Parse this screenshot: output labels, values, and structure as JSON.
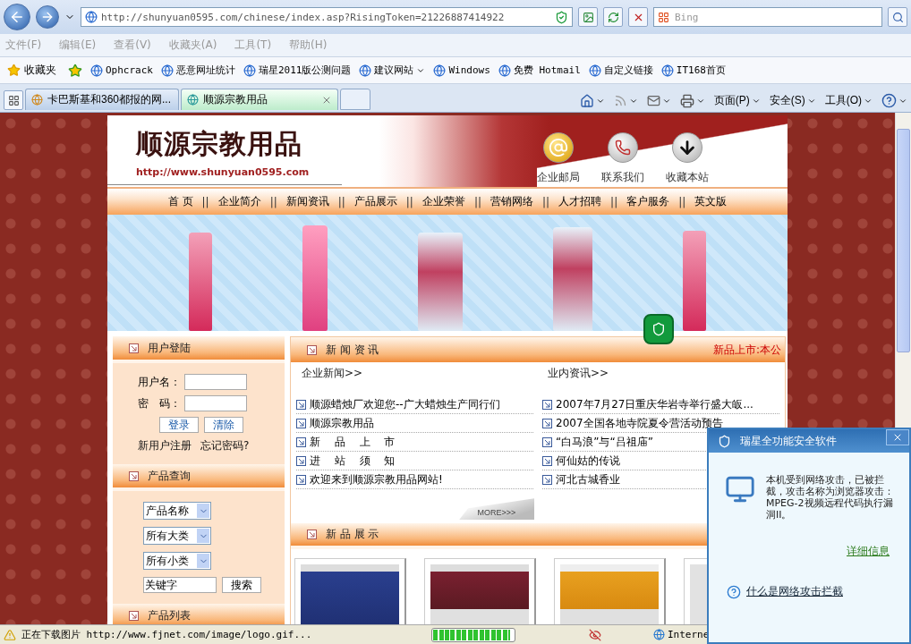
{
  "browser": {
    "address": "http://shunyuan0595.com/chinese/index.asp?RisingToken=21226887414922",
    "search_placeholder": "Bing",
    "menu": [
      "文件(F)",
      "编辑(E)",
      "查看(V)",
      "收藏夹(A)",
      "工具(T)",
      "帮助(H)"
    ],
    "favorites_label": "收藏夹",
    "favorites": [
      {
        "label": "Ophcrack",
        "dropdown": false
      },
      {
        "label": "恶意网址统计",
        "dropdown": false
      },
      {
        "label": "瑞星2011版公测问题",
        "dropdown": false
      },
      {
        "label": "建议网站",
        "dropdown": true
      },
      {
        "label": "Windows",
        "dropdown": false
      },
      {
        "label": "免费 Hotmail",
        "dropdown": false
      },
      {
        "label": "自定义链接",
        "dropdown": false
      },
      {
        "label": "IT168首页",
        "dropdown": false
      }
    ],
    "tabs": [
      {
        "label": "卡巴斯基和360都报的网...",
        "selected": false
      },
      {
        "label": "顺源宗教用品",
        "selected": true
      }
    ],
    "commands": [
      {
        "kind": "home"
      },
      {
        "kind": "feed"
      },
      {
        "kind": "mail"
      },
      {
        "kind": "print"
      },
      {
        "kind": "text",
        "label": "页面(P)"
      },
      {
        "kind": "text",
        "label": "安全(S)"
      },
      {
        "kind": "text",
        "label": "工具(O)"
      },
      {
        "kind": "help"
      }
    ]
  },
  "site": {
    "logo": "顺源宗教用品",
    "logo_url": "http://www.shunyuan0595.com",
    "header_links": [
      {
        "kind": "mail",
        "label": "企业邮局"
      },
      {
        "kind": "contact",
        "label": "联系我们"
      },
      {
        "kind": "bookmark",
        "label": "收藏本站"
      }
    ],
    "nav": [
      {
        "label": "首 页",
        "separator": "||"
      },
      {
        "label": "企业简介",
        "separator": "||"
      },
      {
        "label": "新闻资讯",
        "separator": "||"
      },
      {
        "label": "产品展示",
        "separator": "||"
      },
      {
        "label": "企业荣誉",
        "separator": "||"
      },
      {
        "label": "营销网络",
        "separator": "||"
      },
      {
        "label": "人才招聘",
        "separator": "||"
      },
      {
        "label": "客户服务",
        "separator": "||"
      },
      {
        "label": "英文版"
      }
    ],
    "login": {
      "title": "用户登陆",
      "fields": [
        "用户名：",
        "密　码："
      ],
      "buttons": [
        "登录",
        "清除"
      ],
      "links": [
        "新用户注册",
        "忘记密码?"
      ]
    },
    "search": {
      "title": "产品查询",
      "selects": [
        "产品名称",
        "所有大类",
        "所有小类"
      ],
      "keyword": "关键字",
      "button": "搜索"
    },
    "product_list": {
      "title": "产品列表"
    },
    "news": {
      "title": "新 闻 资 讯",
      "ticker": "新品上市:本公",
      "columns": [
        {
          "heading": "企业新闻>>",
          "items": [
            "顺源蜡烛厂欢迎您--广大蜡烛生产同行们",
            "顺源宗教用品",
            "新　 品　 上　 市",
            "进　 站　 须　 知",
            "欢迎来到顺源宗教用品网站!"
          ]
        },
        {
          "heading": "业内资讯>>",
          "items": [
            "2007年7月27日重庆华岩寺举行盛大皈...",
            "2007全国各地寺院夏令营活动预告",
            "“白马浪”与“吕祖庙”",
            "何仙姑的传说",
            "河北古城香业"
          ]
        }
      ],
      "more": "MORE>>>"
    },
    "new_products": {
      "title": "新 品 展 示"
    }
  },
  "popup": {
    "title": "瑞星全功能安全软件",
    "message": "本机受到网络攻击，已被拦截，攻击名称为浏览器攻击：MPEG-2视频远程代码执行漏洞II。",
    "details": "详细信息",
    "help": "什么是网络攻击拦截"
  },
  "status_bar": {
    "text": "正在下载图片 http://www.fjnet.com/image/logo.gif...",
    "progress": {
      "level": 0.95
    },
    "zone": "Interne"
  }
}
